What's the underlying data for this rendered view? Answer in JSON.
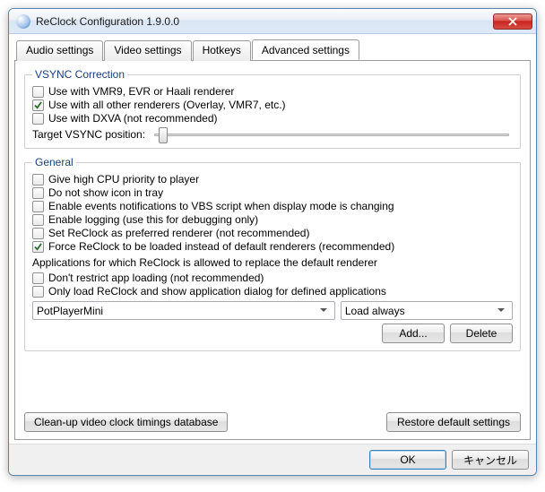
{
  "window": {
    "title": "ReClock Configuration 1.9.0.0"
  },
  "tabs": {
    "audio": "Audio settings",
    "video": "Video settings",
    "hotkeys": "Hotkeys",
    "advanced": "Advanced settings"
  },
  "vsync": {
    "legend": "VSYNC Correction",
    "use_vmr9": {
      "checked": false,
      "label": "Use with VMR9, EVR or Haali renderer"
    },
    "use_other": {
      "checked": true,
      "label": "Use with all other renderers (Overlay, VMR7, etc.)"
    },
    "use_dxva": {
      "checked": false,
      "label": "Use with DXVA (not recommended)"
    },
    "target_label": "Target VSYNC position:"
  },
  "general": {
    "legend": "General",
    "high_cpu": {
      "checked": false,
      "label": "Give high CPU priority to player"
    },
    "no_tray": {
      "checked": false,
      "label": "Do not show icon in tray"
    },
    "events_vbs": {
      "checked": false,
      "label": "Enable events notifications to VBS script when display mode is changing"
    },
    "logging": {
      "checked": false,
      "label": "Enable logging (use this for debugging only)"
    },
    "preferred": {
      "checked": false,
      "label": "Set ReClock as preferred renderer (not recommended)"
    },
    "force_load": {
      "checked": true,
      "label": "Force ReClock to be loaded instead of default renderers (recommended)"
    },
    "apps_label": "Applications for which ReClock is allowed to replace the default renderer",
    "dont_restrict": {
      "checked": false,
      "label": "Don't restrict app loading (not recommended)"
    },
    "only_defined": {
      "checked": false,
      "label": "Only load ReClock and show application dialog for defined applications"
    },
    "app_combo": "PotPlayerMini",
    "mode_combo": "Load always",
    "add_btn": "Add...",
    "delete_btn": "Delete"
  },
  "footer": {
    "cleanup": "Clean-up video clock timings database",
    "restore": "Restore default settings"
  },
  "dialog": {
    "ok": "OK",
    "cancel": "キャンセル"
  }
}
